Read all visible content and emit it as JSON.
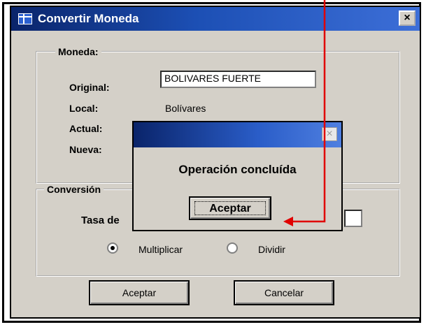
{
  "window": {
    "title": "Convertir Moneda",
    "close_glyph": "×",
    "icon": "form-icon"
  },
  "moneda": {
    "legend": "Moneda:",
    "original_label": "Original:",
    "original_value": "BOLIVARES FUERTE",
    "local_label": "Local:",
    "local_value": "Bolívares",
    "actual_label": "Actual:",
    "nueva_label": "Nueva:"
  },
  "conversion": {
    "legend": "Conversión",
    "tasa_label": "Tasa de",
    "option_multiplicar": "Multiplicar",
    "option_dividir": "Dividir",
    "selected_option": "Multiplicar"
  },
  "buttons": {
    "accept": "Aceptar",
    "cancel": "Cancelar"
  },
  "dialog": {
    "message": "Operación concluída",
    "accept": "Aceptar",
    "close_glyph": "×"
  },
  "colors": {
    "annotation_arrow": "#e00000",
    "titlebar": "#0a246a",
    "face": "#d4d0c8"
  }
}
